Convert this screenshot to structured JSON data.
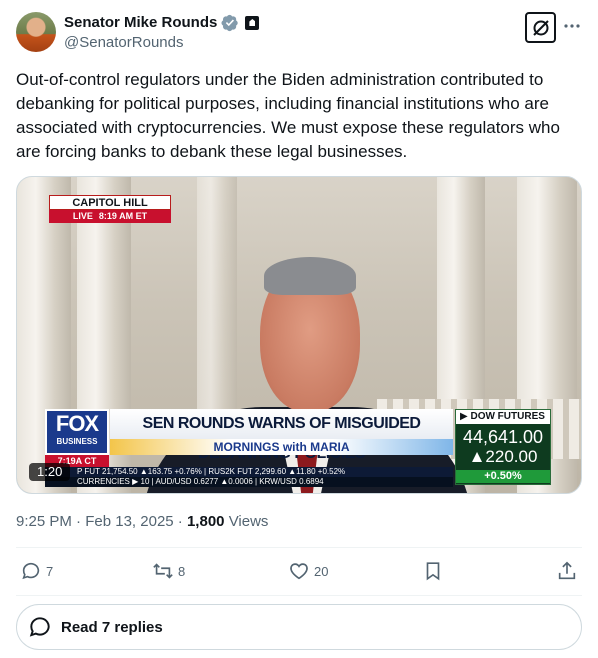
{
  "author": {
    "display_name": "Senator Mike Rounds",
    "handle": "@SenatorRounds",
    "verified_icon": "verified-badge-icon",
    "affiliation_icon": "government-badge-icon"
  },
  "tweet": {
    "text": "Out-of-control regulators under the Biden administration contributed to debanking for political purposes, including financial institutions who are associated with cryptocurrencies. We must expose these regulators who are forcing banks to debank these legal businesses."
  },
  "video": {
    "location_tag": "CAPITOL HILL",
    "live_label": "LIVE",
    "live_time": "8:19 AM ET",
    "network_logo": "FOX",
    "network_sub": "BUSINESS",
    "network_time": "7:19A CT",
    "headline": "SEN ROUNDS WARNS OF MISGUIDED DEBANKING POLICIES",
    "show_name": "MORNINGS with MARIA",
    "ticker_line_1": "P FUT  21,754.50 ▲163.75 +0.76% | RUS2K FUT  2,299.60 ▲11.80 +0.52%",
    "ticker_line_2": "CURRENCIES ▶ 10  |  AUD/USD 0.6277 ▲0.0006  |  KRW/USD 0.6894",
    "dow_title": "▶ DOW FUTURES",
    "dow_value": "44,641.00",
    "dow_change": "▲220.00",
    "dow_pct": "+0.50%",
    "duration": "1:20"
  },
  "meta": {
    "time": "9:25 PM",
    "separator": "·",
    "date": "Feb 13, 2025",
    "views_count": "1,800",
    "views_label": "Views"
  },
  "actions": {
    "replies": "7",
    "reposts": "8",
    "likes": "20"
  },
  "read_replies": {
    "label": "Read 7 replies"
  },
  "colors": {
    "text_primary": "#0f1419",
    "text_secondary": "#536471",
    "verified_blue": "#829aab",
    "border": "#cfd9de"
  }
}
